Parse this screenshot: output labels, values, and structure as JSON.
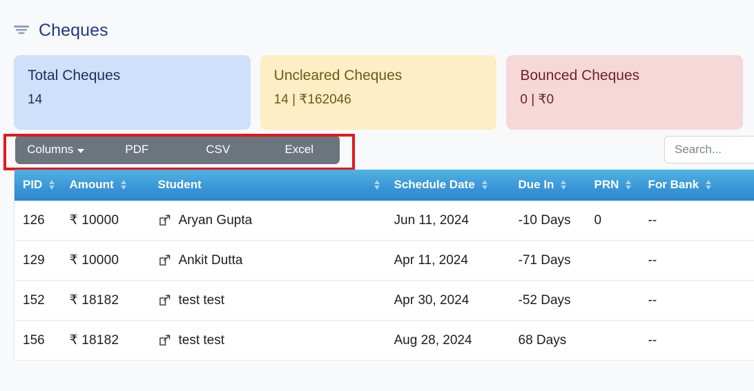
{
  "header": {
    "icon": "filter-icon",
    "title": "Cheques"
  },
  "stats": [
    {
      "title": "Total Cheques",
      "value": "14",
      "color": "#cfe0fa",
      "text_color": "#16305e"
    },
    {
      "title": "Uncleared Cheques",
      "value": "14 | ₹162046",
      "color": "#fdeec6",
      "text_color": "#6b5a18"
    },
    {
      "title": "Bounced Cheques",
      "value": "0 | ₹0",
      "color": "#f7d8d8",
      "text_color": "#6b1f28"
    }
  ],
  "toolbar": {
    "columns_label": "Columns",
    "pdf_label": "PDF",
    "csv_label": "CSV",
    "excel_label": "Excel",
    "highlight_color": "#e3181e",
    "button_color": "#6c757d"
  },
  "search": {
    "value": "",
    "placeholder": "Search..."
  },
  "table": {
    "header_color": "#3b97d8",
    "columns": [
      {
        "label": "PID",
        "sortable": true
      },
      {
        "label": "Amount",
        "sortable": true
      },
      {
        "label": "Student",
        "sortable": true
      },
      {
        "label": "Schedule Date",
        "sortable": true
      },
      {
        "label": "Due In",
        "sortable": true
      },
      {
        "label": "PRN",
        "sortable": true
      },
      {
        "label": "For Bank",
        "sortable": true
      }
    ],
    "rows": [
      {
        "pid": "126",
        "amount": "₹ 10000",
        "student": "Aryan Gupta",
        "schedule_date": "Jun 11, 2024",
        "due_in": "-10 Days",
        "due_state": "negative",
        "prn": "0",
        "for_bank": "--"
      },
      {
        "pid": "129",
        "amount": "₹ 10000",
        "student": "Ankit Dutta",
        "schedule_date": "Apr 11, 2024",
        "due_in": "-71 Days",
        "due_state": "negative",
        "prn": "",
        "for_bank": "--"
      },
      {
        "pid": "152",
        "amount": "₹ 18182",
        "student": "test test",
        "schedule_date": "Apr 30, 2024",
        "due_in": "-52 Days",
        "due_state": "negative",
        "prn": "",
        "for_bank": "--"
      },
      {
        "pid": "156",
        "amount": "₹ 18182",
        "student": "test test",
        "schedule_date": "Aug 28, 2024",
        "due_in": "68 Days",
        "due_state": "positive",
        "prn": "",
        "for_bank": "--"
      }
    ]
  }
}
